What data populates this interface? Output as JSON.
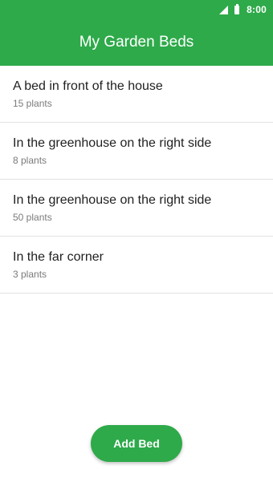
{
  "status_bar": {
    "time": "8:00",
    "icons": [
      "signal-icon",
      "battery-icon"
    ]
  },
  "app_bar": {
    "title": "My Garden Beds"
  },
  "beds": [
    {
      "name": "A bed in front of the house",
      "count": "15 plants"
    },
    {
      "name": "In the greenhouse on the right side",
      "count": "8 plants"
    },
    {
      "name": "In the greenhouse on the right side",
      "count": "50 plants"
    },
    {
      "name": "In the far corner",
      "count": "3 plants"
    }
  ],
  "actions": {
    "add_label": "Add Bed"
  },
  "colors": {
    "primary": "#2eaa4a",
    "text_primary": "#212121",
    "text_secondary": "#7a7a7a",
    "divider": "#e2e2e2"
  }
}
